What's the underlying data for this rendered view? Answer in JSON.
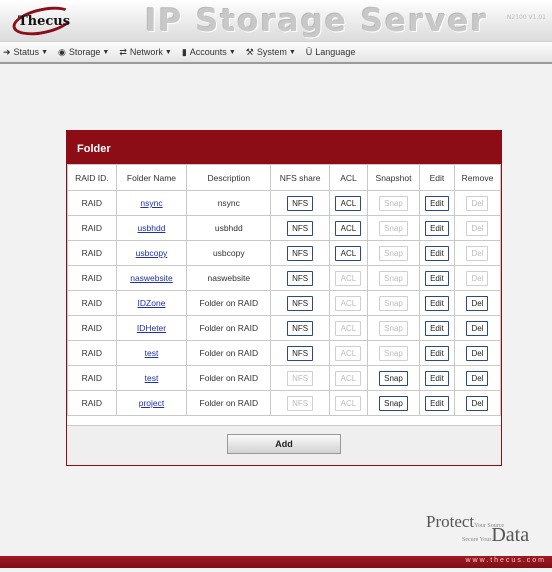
{
  "header": {
    "logo_text": "Thecus",
    "title": "IP Storage Server",
    "model": "N2100 V1.01"
  },
  "menu": [
    {
      "label": "Status",
      "icon": "arrow-icon"
    },
    {
      "label": "Storage",
      "icon": "disc-icon"
    },
    {
      "label": "Network",
      "icon": "network-icon"
    },
    {
      "label": "Accounts",
      "icon": "users-icon"
    },
    {
      "label": "System",
      "icon": "wrench-icon"
    },
    {
      "label": "Language",
      "icon": "language-icon"
    }
  ],
  "panel": {
    "title": "Folder",
    "columns": [
      "RAID ID.",
      "Folder Name",
      "Description",
      "NFS share",
      "ACL",
      "Snapshot",
      "Edit",
      "Remove"
    ],
    "rows": [
      {
        "raid": "RAID",
        "name": "nsync",
        "desc": "nsync",
        "nfs": "NFS",
        "nfs_on": true,
        "acl": "ACL",
        "acl_on": true,
        "snap": "Snap",
        "snap_on": false,
        "edit": "Edit",
        "del": "Del",
        "del_on": false
      },
      {
        "raid": "RAID",
        "name": "usbhdd",
        "desc": "usbhdd",
        "nfs": "NFS",
        "nfs_on": true,
        "acl": "ACL",
        "acl_on": true,
        "snap": "Snap",
        "snap_on": false,
        "edit": "Edit",
        "del": "Del",
        "del_on": false
      },
      {
        "raid": "RAID",
        "name": "usbcopy",
        "desc": "usbcopy",
        "nfs": "NFS",
        "nfs_on": true,
        "acl": "ACL",
        "acl_on": true,
        "snap": "Snap",
        "snap_on": false,
        "edit": "Edit",
        "del": "Del",
        "del_on": false
      },
      {
        "raid": "RAID",
        "name": "naswebsite",
        "desc": "naswebsite",
        "nfs": "NFS",
        "nfs_on": true,
        "acl": "ACL",
        "acl_on": false,
        "snap": "Snap",
        "snap_on": false,
        "edit": "Edit",
        "del": "Del",
        "del_on": false
      },
      {
        "raid": "RAID",
        "name": "IDZone",
        "desc": "Folder on RAID",
        "nfs": "NFS",
        "nfs_on": true,
        "acl": "ACL",
        "acl_on": false,
        "snap": "Snap",
        "snap_on": false,
        "edit": "Edit",
        "del": "Del",
        "del_on": true
      },
      {
        "raid": "RAID",
        "name": "IDHeter",
        "desc": "Folder on RAID",
        "nfs": "NFS",
        "nfs_on": true,
        "acl": "ACL",
        "acl_on": false,
        "snap": "Snap",
        "snap_on": false,
        "edit": "Edit",
        "del": "Del",
        "del_on": true
      },
      {
        "raid": "RAID",
        "name": "test",
        "desc": "Folder on RAID",
        "nfs": "NFS",
        "nfs_on": true,
        "acl": "ACL",
        "acl_on": false,
        "snap": "Snap",
        "snap_on": false,
        "edit": "Edit",
        "del": "Del",
        "del_on": true
      },
      {
        "raid": "RAID",
        "name": "test",
        "desc": "Folder on RAID",
        "nfs": "NFS",
        "nfs_on": false,
        "acl": "ACL",
        "acl_on": false,
        "snap": "Snap",
        "snap_on": true,
        "edit": "Edit",
        "del": "Del",
        "del_on": true
      },
      {
        "raid": "RAID",
        "name": "project",
        "desc": "Folder on RAID",
        "nfs": "NFS",
        "nfs_on": false,
        "acl": "ACL",
        "acl_on": false,
        "snap": "Snap",
        "snap_on": true,
        "edit": "Edit",
        "del": "Del",
        "del_on": true
      }
    ],
    "add_label": "Add"
  },
  "footer": {
    "protect": "Protect",
    "protect_small": "Your Source",
    "secure_small": "Secure Your",
    "data": "Data",
    "url": "www.thecus.com"
  },
  "colors": {
    "accent": "#8d0d16",
    "link": "#1f2fb0",
    "button_border": "#2a4a87"
  }
}
